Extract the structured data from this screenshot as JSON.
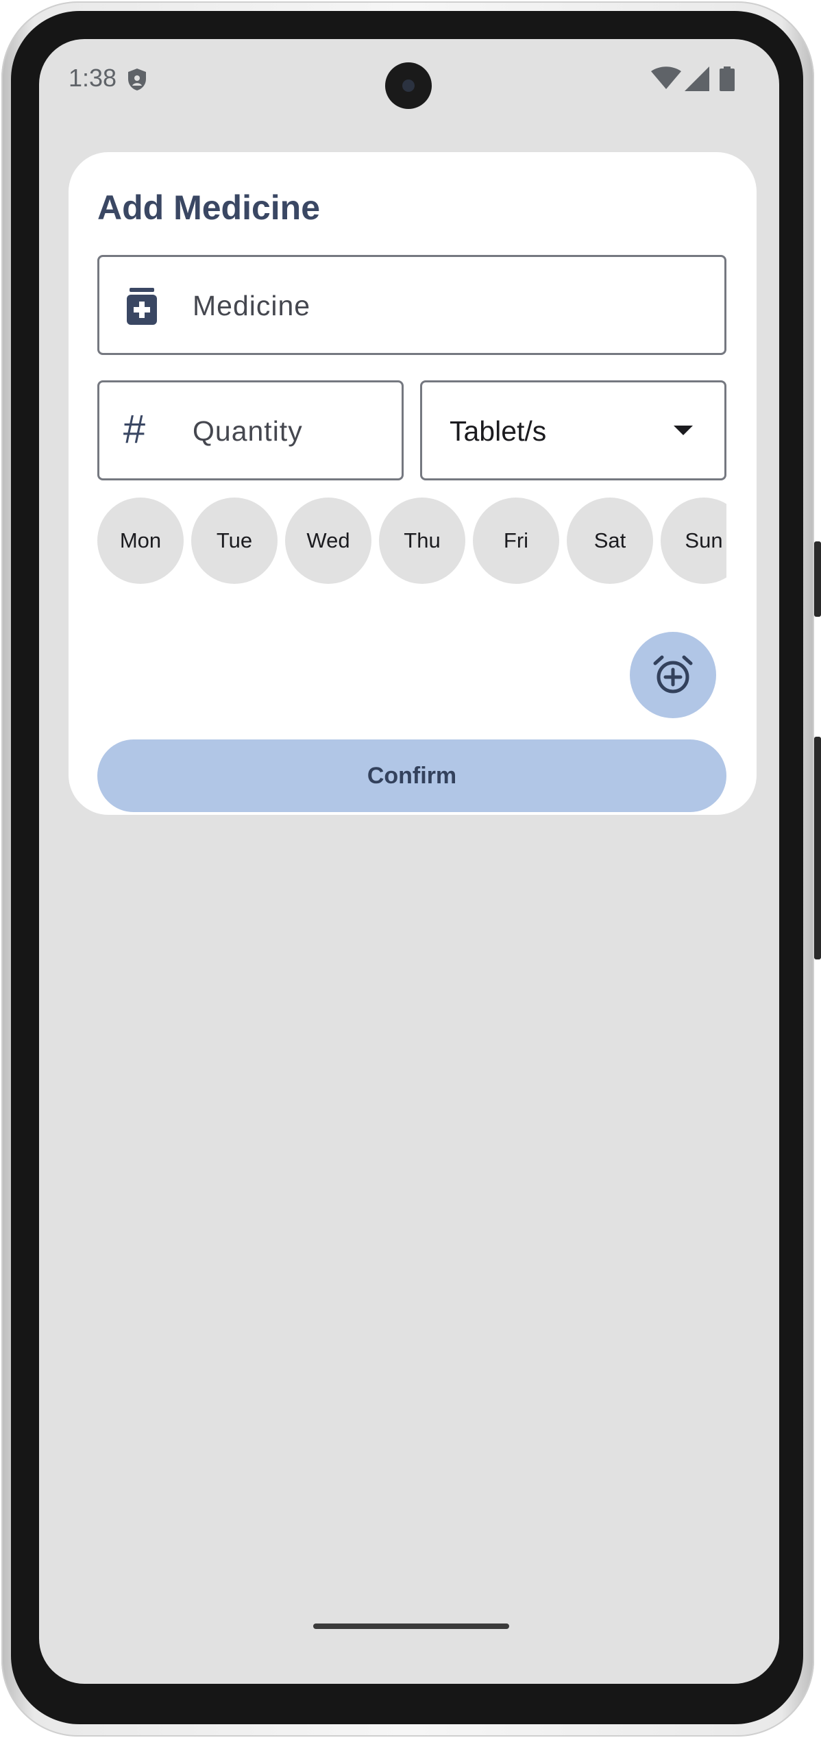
{
  "status_bar": {
    "time": "1:38",
    "icons": [
      "shield-icon",
      "wifi-icon",
      "signal-icon",
      "battery-icon"
    ]
  },
  "dialog": {
    "title": "Add Medicine",
    "medicine_field": {
      "placeholder": "Medicine",
      "icon": "medicine-bottle-icon"
    },
    "quantity_field": {
      "placeholder": "Quantity",
      "icon": "hash-icon",
      "icon_glyph": "#"
    },
    "unit_dropdown": {
      "value": "Tablet/s",
      "icon": "dropdown-arrow-icon"
    },
    "days": [
      {
        "label": "Mon"
      },
      {
        "label": "Tue"
      },
      {
        "label": "Wed"
      },
      {
        "label": "Thu"
      },
      {
        "label": "Fri"
      },
      {
        "label": "Sat"
      },
      {
        "label": "Sun"
      }
    ],
    "add_alarm_icon": "alarm-add-icon",
    "confirm_label": "Confirm"
  },
  "colors": {
    "screen_background": "#e1e1e1",
    "card": "#ffffff",
    "title_text": "#3a4763",
    "accent_container": "#b1c6e6",
    "day_chip": "#e1e1e1"
  }
}
